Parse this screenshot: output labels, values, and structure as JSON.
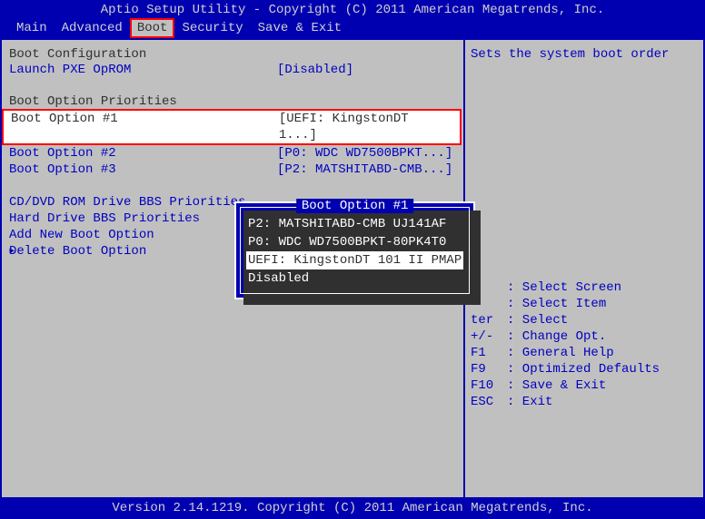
{
  "header": {
    "title": "Aptio Setup Utility - Copyright (C) 2011 American Megatrends, Inc."
  },
  "tabs": {
    "items": [
      "Main",
      "Advanced",
      "Boot",
      "Security",
      "Save & Exit"
    ],
    "selected": "Boot"
  },
  "left": {
    "section1_header": "Boot Configuration",
    "pxe_label": "Launch PXE OpROM",
    "pxe_value": "[Disabled]",
    "section2_header": "Boot Option Priorities",
    "boot1_label": "Boot Option #1",
    "boot1_value": "[UEFI: KingstonDT 1...]",
    "boot2_label": "Boot Option #2",
    "boot2_value": "[P0: WDC WD7500BPKT...]",
    "boot3_label": "Boot Option #3",
    "boot3_value": "[P2: MATSHITABD-CMB...]",
    "cdrom_prio": "CD/DVD ROM Drive BBS Priorities",
    "hdd_prio": "Hard Drive BBS Priorities",
    "add_opt": "Add New Boot Option",
    "del_opt": "Delete Boot Option"
  },
  "popup": {
    "title": "Boot Option #1",
    "items": [
      "P2: MATSHITABD-CMB UJ141AF",
      "P0: WDC WD7500BPKT-80PK4T0",
      "UEFI: KingstonDT 101 II PMAP",
      "Disabled"
    ],
    "selectedIndex": 2
  },
  "right": {
    "help": "Sets the system boot order",
    "legend": [
      {
        "key": "",
        "desc": ": Select Screen"
      },
      {
        "key": "",
        "desc": ": Select Item"
      },
      {
        "key": "ter",
        "desc": ": Select"
      },
      {
        "key": "+/-",
        "desc": ": Change Opt."
      },
      {
        "key": "F1",
        "desc": ": General Help"
      },
      {
        "key": "F9",
        "desc": ": Optimized Defaults"
      },
      {
        "key": "F10",
        "desc": ": Save & Exit"
      },
      {
        "key": "ESC",
        "desc": ": Exit"
      }
    ]
  },
  "footer": {
    "text": "Version 2.14.1219. Copyright (C) 2011 American Megatrends, Inc."
  }
}
